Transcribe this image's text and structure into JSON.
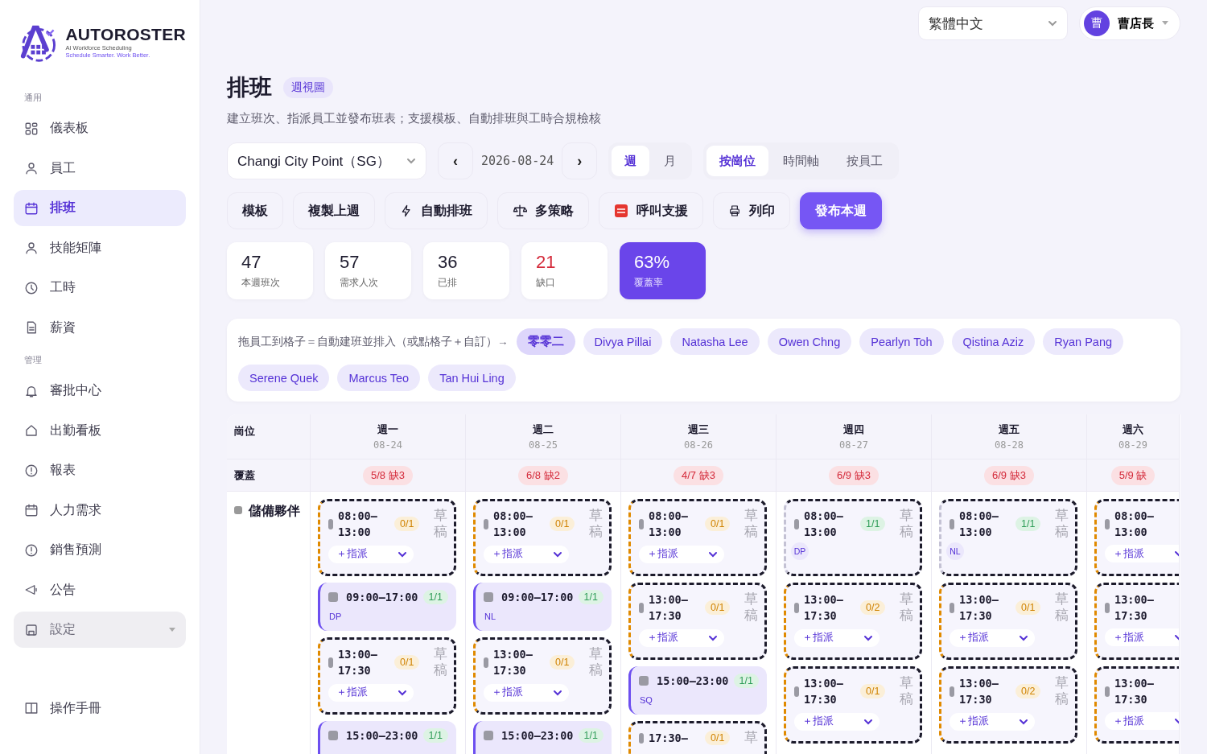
{
  "sidebar": {
    "logo": {
      "name": "AUTOROSTER",
      "tagline": "AI Workforce Scheduling",
      "slogan": "Schedule Smarter. Work Better."
    },
    "sections": [
      {
        "title": "通用",
        "items": [
          {
            "label": "儀表板",
            "selected": false
          },
          {
            "label": "員工",
            "selected": false
          },
          {
            "label": "排班",
            "selected": true
          },
          {
            "label": "技能矩陣",
            "selected": false
          },
          {
            "label": "工時",
            "selected": false
          },
          {
            "label": "薪資",
            "selected": false
          }
        ]
      },
      {
        "title": "管理",
        "items": [
          {
            "label": "審批中心",
            "selected": false
          },
          {
            "label": "出勤看板",
            "selected": false
          },
          {
            "label": "報表",
            "selected": false
          },
          {
            "label": "人力需求",
            "selected": false
          },
          {
            "label": "銷售預測",
            "selected": false
          },
          {
            "label": "公告",
            "selected": false
          },
          {
            "label": "設定",
            "selected": false,
            "kind": "group",
            "expanded": false
          }
        ]
      }
    ],
    "footer": {
      "label": "操作手冊"
    }
  },
  "topbar": {
    "language": "繁體中文",
    "user": {
      "avatar": "曹",
      "name": "曹店長"
    }
  },
  "header": {
    "title": "排班",
    "badge": "週視圖",
    "subtitle": "建立班次、指派員工並發布班表；支援模板、自動排班與工時合規檢核"
  },
  "controls": {
    "location": "Changi City Point（SG）",
    "prev": "‹",
    "date": "2026-08-24",
    "next": "›",
    "range_tabs": [
      {
        "label": "週",
        "selected": true
      },
      {
        "label": "月",
        "selected": false
      }
    ],
    "view_tabs": [
      {
        "label": "按崗位",
        "selected": true
      },
      {
        "label": "時間軸",
        "selected": false
      },
      {
        "label": "按員工",
        "selected": false
      }
    ]
  },
  "actions": [
    {
      "label": "模板",
      "kind": "plain"
    },
    {
      "label": "複製上週",
      "kind": "plain"
    },
    {
      "label": "自動排班",
      "kind": "plain"
    },
    {
      "label": "多策略",
      "kind": "plain"
    },
    {
      "label": "呼叫支援",
      "kind": "plain"
    },
    {
      "label": "列印",
      "kind": "plain"
    },
    {
      "label": "發布本週",
      "kind": "primary"
    }
  ],
  "stats": [
    {
      "value": "47",
      "label": "本週班次",
      "kind": "plain"
    },
    {
      "value": "57",
      "label": "需求人次",
      "kind": "plain"
    },
    {
      "value": "36",
      "label": "已排",
      "kind": "plain"
    },
    {
      "value": "21",
      "label": "缺口",
      "kind": "alert"
    },
    {
      "value": "63%",
      "label": "覆蓋率",
      "kind": "highlight"
    }
  ],
  "staff": {
    "hint": "拖員工到格子＝自動建班並排入（或點格子＋自訂）→",
    "chips": [
      {
        "name": "零零二",
        "selected": true
      },
      {
        "name": "Divya Pillai",
        "selected": false
      },
      {
        "name": "Natasha Lee",
        "selected": false
      },
      {
        "name": "Owen Chng",
        "selected": false
      },
      {
        "name": "Pearlyn Toh",
        "selected": false
      },
      {
        "name": "Qistina Aziz",
        "selected": false
      },
      {
        "name": "Ryan Pang",
        "selected": false
      },
      {
        "name": "Serene Quek",
        "selected": false
      },
      {
        "name": "Marcus Teo",
        "selected": false
      },
      {
        "name": "Tan Hui Ling",
        "selected": false
      }
    ]
  },
  "roster": {
    "corner": "崗位",
    "coverage_label": "覆蓋",
    "role": "儲備夥伴",
    "days": [
      {
        "day": "週一",
        "date": "08-24",
        "coverage": "5/8 缺3",
        "shifts": [
          {
            "kind": "open",
            "time": "08:00–13:00",
            "count": "0/1",
            "status": "草稿",
            "assign": "＋指派"
          },
          {
            "kind": "filled",
            "time": "09:00–17:00",
            "count": "1/1",
            "assignee": "DP"
          },
          {
            "kind": "open",
            "time": "13:00–17:30",
            "count": "0/1",
            "status": "草稿",
            "assign": "＋指派"
          },
          {
            "kind": "filled",
            "time": "15:00–23:00",
            "count": "1/1"
          }
        ]
      },
      {
        "day": "週二",
        "date": "08-25",
        "coverage": "6/8 缺2",
        "shifts": [
          {
            "kind": "open",
            "time": "08:00–13:00",
            "count": "0/1",
            "status": "草稿",
            "assign": "＋指派"
          },
          {
            "kind": "filled",
            "time": "09:00–17:00",
            "count": "1/1",
            "assignee": "NL"
          },
          {
            "kind": "open",
            "time": "13:00–17:30",
            "count": "0/1",
            "status": "草稿",
            "assign": "＋指派"
          },
          {
            "kind": "filled",
            "time": "15:00–23:00",
            "count": "1/1"
          }
        ]
      },
      {
        "day": "週三",
        "date": "08-26",
        "coverage": "4/7 缺3",
        "shifts": [
          {
            "kind": "open",
            "time": "08:00–13:00",
            "count": "0/1",
            "status": "草稿",
            "assign": "＋指派"
          },
          {
            "kind": "open",
            "time": "13:00–17:30",
            "count": "0/1",
            "status": "草稿",
            "assign": "＋指派"
          },
          {
            "kind": "filled",
            "time": "15:00–23:00",
            "count": "1/1",
            "assignee": "SQ"
          },
          {
            "kind": "open",
            "time": "17:30–",
            "count": "0/1",
            "status": "草"
          }
        ]
      },
      {
        "day": "週四",
        "date": "08-27",
        "coverage": "6/9 缺3",
        "shifts": [
          {
            "kind": "draft",
            "time": "08:00–13:00",
            "count": "1/1",
            "status": "草稿",
            "assignee": "DP"
          },
          {
            "kind": "open",
            "time": "13:00–17:30",
            "count": "0/2",
            "status": "草稿",
            "assign": "＋指派"
          },
          {
            "kind": "open",
            "time": "13:00–17:30",
            "count": "0/1",
            "status": "草稿",
            "assign": "＋指派"
          }
        ]
      },
      {
        "day": "週五",
        "date": "08-28",
        "coverage": "6/9 缺3",
        "shifts": [
          {
            "kind": "draft",
            "time": "08:00–13:00",
            "count": "1/1",
            "status": "草稿",
            "assignee": "NL"
          },
          {
            "kind": "open",
            "time": "13:00–17:30",
            "count": "0/1",
            "status": "草稿",
            "assign": "＋指派"
          },
          {
            "kind": "open",
            "time": "13:00–17:30",
            "count": "0/2",
            "status": "草稿",
            "assign": "＋指派"
          }
        ]
      },
      {
        "day": "週六",
        "date": "08-29",
        "coverage": "5/9 缺",
        "shifts": [
          {
            "kind": "open",
            "time": "08:00–13:00",
            "assign": "＋指派"
          },
          {
            "kind": "open",
            "time": "13:00–17:30",
            "assign": "＋指派"
          },
          {
            "kind": "open",
            "time": "13:00–17:30",
            "assign": "＋指派"
          }
        ]
      }
    ]
  }
}
